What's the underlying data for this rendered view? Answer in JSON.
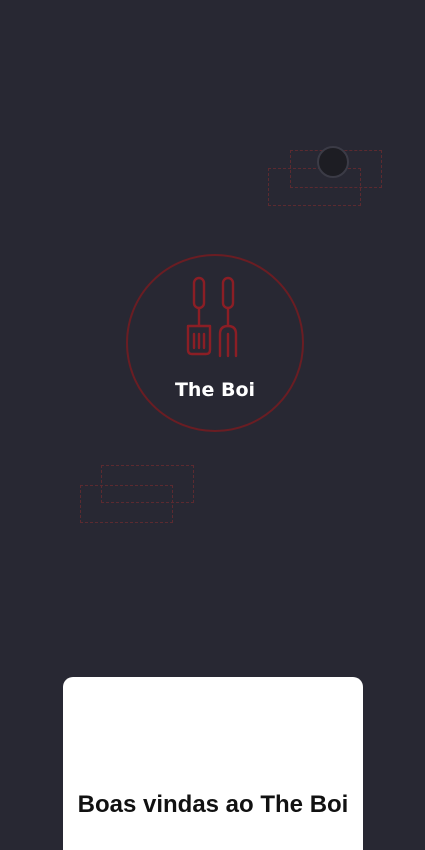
{
  "brand": {
    "name": "The Boi",
    "logo_icon": "spatula-and-fork-icon",
    "accent_color": "#8b1e25"
  },
  "welcome": {
    "title": "Boas vindas ao The Boi"
  },
  "colors": {
    "background": "#282833",
    "card": "#ffffff",
    "text_light": "#ffffff",
    "text_dark": "#111111"
  }
}
